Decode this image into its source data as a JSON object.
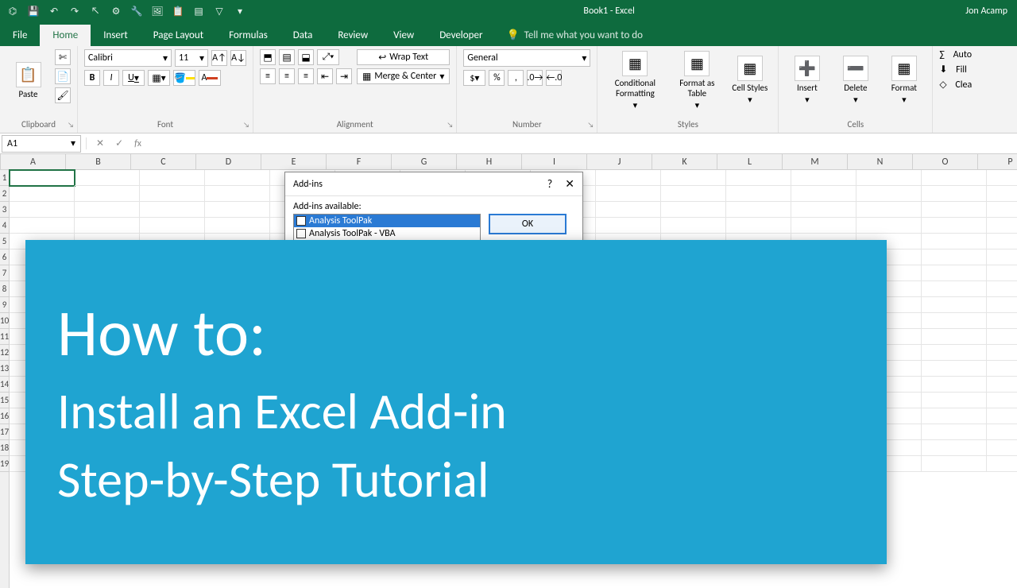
{
  "titlebar": {
    "title": "Book1 - Excel",
    "user": "Jon Acamp"
  },
  "tabs": [
    "File",
    "Home",
    "Insert",
    "Page Layout",
    "Formulas",
    "Data",
    "Review",
    "View",
    "Developer"
  ],
  "active_tab": "Home",
  "tell_me": "Tell me what you want to do",
  "ribbon": {
    "clipboard": {
      "label": "Clipboard",
      "paste": "Paste"
    },
    "font": {
      "label": "Font",
      "name": "Calibri",
      "size": "11",
      "b": "B",
      "i": "I",
      "u": "U"
    },
    "alignment": {
      "label": "Alignment",
      "wrap": "Wrap Text",
      "merge": "Merge & Center"
    },
    "number": {
      "label": "Number",
      "format": "General"
    },
    "styles": {
      "label": "Styles",
      "cond": "Conditional Formatting",
      "table": "Format as Table",
      "cell": "Cell Styles"
    },
    "cells": {
      "label": "Cells",
      "insert": "Insert",
      "delete": "Delete",
      "format": "Format"
    },
    "editing": {
      "auto": "Auto",
      "fill": "Fill",
      "clear": "Clea"
    }
  },
  "namebox": "A1",
  "columns": [
    "A",
    "B",
    "C",
    "D",
    "E",
    "F",
    "G",
    "H",
    "I",
    "J",
    "K",
    "L",
    "M",
    "N",
    "O",
    "P"
  ],
  "row_count": 19,
  "dialog": {
    "title": "Add-ins",
    "available": "Add-ins available:",
    "items": [
      "Analysis ToolPak",
      "Analysis ToolPak - VBA"
    ],
    "ok": "OK"
  },
  "overlay": {
    "h1": "How to:",
    "line2": "Install an Excel Add-in",
    "line3": "Step-by-Step Tutorial"
  }
}
